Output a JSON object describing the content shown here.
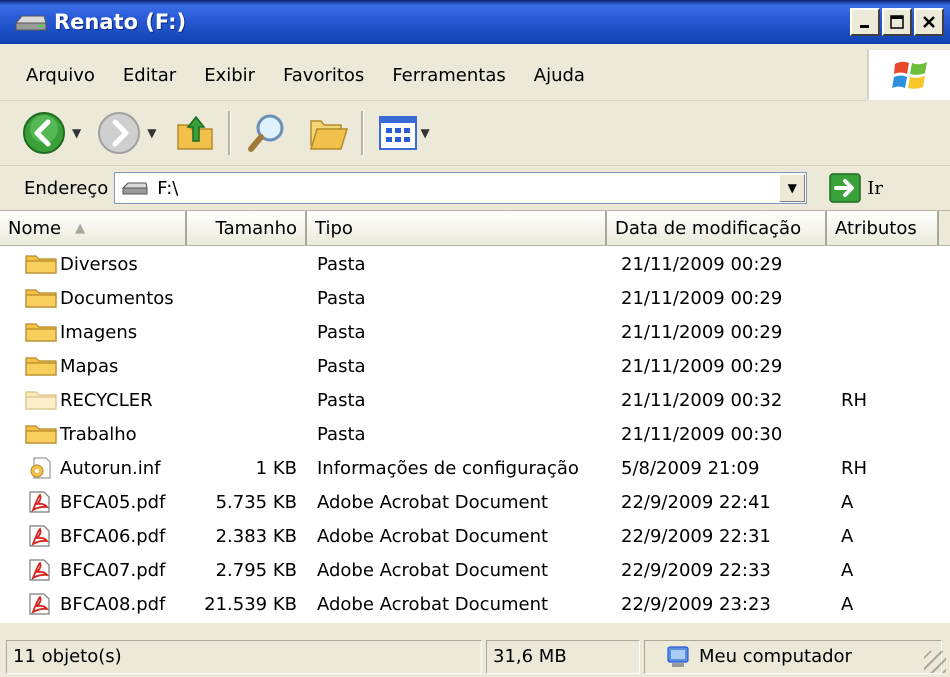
{
  "window": {
    "title": "Renato (F:)"
  },
  "menu": [
    "Arquivo",
    "Editar",
    "Exibir",
    "Favoritos",
    "Ferramentas",
    "Ajuda"
  ],
  "toolbar": {
    "icons": [
      "back-arrow-icon",
      "forward-arrow-icon",
      "folder-up-icon",
      "search-icon",
      "folders-icon",
      "views-icon"
    ]
  },
  "address": {
    "label": "Endereço",
    "value": "F:\\",
    "go_label": "Ir"
  },
  "columns": {
    "name": "Nome",
    "size": "Tamanho",
    "type": "Tipo",
    "date": "Data de modificação",
    "attr": "Atributos"
  },
  "files": [
    {
      "name": "Diversos",
      "size": "",
      "type": "Pasta",
      "date": "21/11/2009 00:29",
      "attr": "",
      "icon": "folder-icon"
    },
    {
      "name": "Documentos",
      "size": "",
      "type": "Pasta",
      "date": "21/11/2009 00:29",
      "attr": "",
      "icon": "folder-icon"
    },
    {
      "name": "Imagens",
      "size": "",
      "type": "Pasta",
      "date": "21/11/2009 00:29",
      "attr": "",
      "icon": "folder-icon"
    },
    {
      "name": "Mapas",
      "size": "",
      "type": "Pasta",
      "date": "21/11/2009 00:29",
      "attr": "",
      "icon": "folder-icon"
    },
    {
      "name": "RECYCLER",
      "size": "",
      "type": "Pasta",
      "date": "21/11/2009 00:32",
      "attr": "RH",
      "icon": "hidden-folder-icon"
    },
    {
      "name": "Trabalho",
      "size": "",
      "type": "Pasta",
      "date": "21/11/2009 00:30",
      "attr": "",
      "icon": "folder-icon"
    },
    {
      "name": "Autorun.inf",
      "size": "1 KB",
      "type": "Informações de configuração",
      "date": "5/8/2009 21:09",
      "attr": "RH",
      "icon": "config-file-icon"
    },
    {
      "name": "BFCA05.pdf",
      "size": "5.735 KB",
      "type": "Adobe Acrobat Document",
      "date": "22/9/2009 22:41",
      "attr": "A",
      "icon": "pdf-icon"
    },
    {
      "name": "BFCA06.pdf",
      "size": "2.383 KB",
      "type": "Adobe Acrobat Document",
      "date": "22/9/2009 22:31",
      "attr": "A",
      "icon": "pdf-icon"
    },
    {
      "name": "BFCA07.pdf",
      "size": "2.795 KB",
      "type": "Adobe Acrobat Document",
      "date": "22/9/2009 22:33",
      "attr": "A",
      "icon": "pdf-icon"
    },
    {
      "name": "BFCA08.pdf",
      "size": "21.539 KB",
      "type": "Adobe Acrobat Document",
      "date": "22/9/2009 23:23",
      "attr": "A",
      "icon": "pdf-icon"
    }
  ],
  "status": {
    "objects": "11 objeto(s)",
    "size": "31,6 MB",
    "zone": "Meu computador"
  },
  "colors": {
    "title_bar": "#2a5bd7",
    "folder": "#f5c243",
    "pdf": "#d7261e",
    "window_bg": "#ece9d8"
  }
}
